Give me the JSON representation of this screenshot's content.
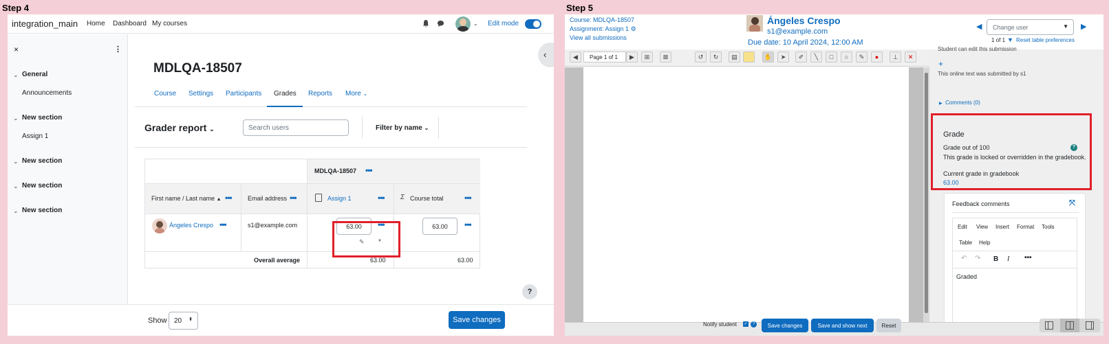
{
  "step4": {
    "label": "Step 4",
    "navbar": {
      "site_name": "integration_main",
      "links": [
        "Home",
        "Dashboard",
        "My courses"
      ],
      "edit_mode": "Edit mode"
    },
    "drawer": {
      "sections": [
        {
          "title": "General",
          "items": [
            "Announcements"
          ]
        },
        {
          "title": "New section",
          "items": [
            "Assign 1"
          ]
        },
        {
          "title": "New section",
          "items": []
        },
        {
          "title": "New section",
          "items": []
        },
        {
          "title": "New section",
          "items": []
        }
      ]
    },
    "course_title": "MDLQA-18507",
    "tabs": [
      "Course",
      "Settings",
      "Participants",
      "Grades",
      "Reports",
      "More"
    ],
    "active_tab": "Grades",
    "report_title": "Grader report",
    "search_placeholder": "Search users",
    "filter_label": "Filter by name",
    "table": {
      "category_header": "MDLQA-18507",
      "col_name": "First name / Last name",
      "col_email": "Email address",
      "col_assign": "Assign 1",
      "col_total": "Course total",
      "row": {
        "name": "Ángeles Crespo",
        "email": "s1@example.com",
        "assign_grade": "63.00",
        "total_grade": "63.00"
      },
      "avg_label": "Overall average",
      "avg_assign": "63.00",
      "avg_total": "63.00"
    },
    "help": "?",
    "footer": {
      "show_label": "Show",
      "show_value": "20",
      "save": "Save changes"
    }
  },
  "step5": {
    "label": "Step 5",
    "header": {
      "course": "Course: MDLQA-18507",
      "assignment": "Assignment: Assign 1",
      "view_all": "View all submissions",
      "user_name": "Ángeles Crespo",
      "user_email": "s1@example.com",
      "due": "Due date: 10 April 2024, 12:00 AM",
      "change_user_placeholder": "Change user",
      "pagination": "1 of 1",
      "reset_prefs": "Reset table preferences"
    },
    "toolbar": {
      "page": "Page 1 of 1"
    },
    "panel": {
      "can_edit": "Student can edit this submission",
      "plus": "+",
      "submitted": "This online text was submitted by s1",
      "comments": "Comments (0)",
      "grade_heading": "Grade",
      "grade_out_of": "Grade out of 100",
      "locked": "This grade is locked or overridden in the gradebook.",
      "current_grade_label": "Current grade in gradebook",
      "current_grade": "63.00",
      "feedback_title": "Feedback comments",
      "editor_menu": [
        "Edit",
        "View",
        "Insert",
        "Format",
        "Tools",
        "Table",
        "Help"
      ],
      "editor_text": "Graded"
    },
    "footer": {
      "notify": "Notify student",
      "save": "Save changes",
      "save_next": "Save and show next",
      "reset": "Reset"
    }
  }
}
